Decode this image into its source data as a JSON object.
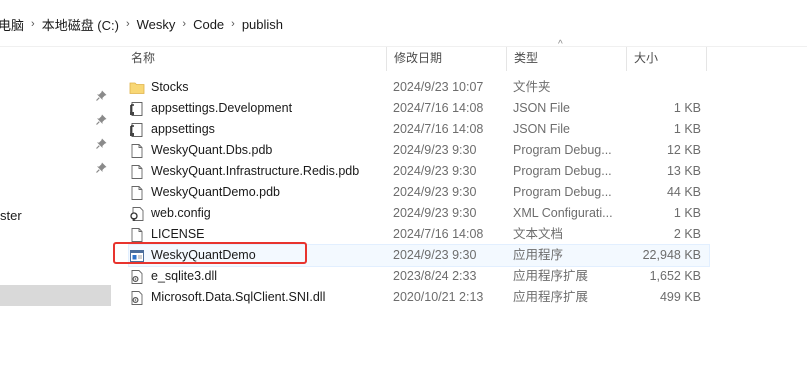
{
  "breadcrumb": {
    "items": [
      "电脑",
      "本地磁盘 (C:)",
      "Wesky",
      "Code",
      "publish"
    ],
    "separator": "›"
  },
  "sidebar": {
    "partial_label": "ster",
    "pin_icon": "pin-icon"
  },
  "columns": {
    "name": "名称",
    "date": "修改日期",
    "type": "类型",
    "size": "大小",
    "sort_indicator": "^"
  },
  "files": [
    {
      "name": "Stocks",
      "date": "2024/9/23 10:07",
      "type": "文件夹",
      "size": "",
      "icon": "folder-icon"
    },
    {
      "name": "appsettings.Development",
      "date": "2024/7/16 14:08",
      "type": "JSON File",
      "size": "1 KB",
      "icon": "json-file-icon"
    },
    {
      "name": "appsettings",
      "date": "2024/7/16 14:08",
      "type": "JSON File",
      "size": "1 KB",
      "icon": "json-file-icon"
    },
    {
      "name": "WeskyQuant.Dbs.pdb",
      "date": "2024/9/23 9:30",
      "type": "Program Debug...",
      "size": "12 KB",
      "icon": "file-icon"
    },
    {
      "name": "WeskyQuant.Infrastructure.Redis.pdb",
      "date": "2024/9/23 9:30",
      "type": "Program Debug...",
      "size": "13 KB",
      "icon": "file-icon"
    },
    {
      "name": "WeskyQuantDemo.pdb",
      "date": "2024/9/23 9:30",
      "type": "Program Debug...",
      "size": "44 KB",
      "icon": "file-icon"
    },
    {
      "name": "web.config",
      "date": "2024/9/23 9:30",
      "type": "XML Configurati...",
      "size": "1 KB",
      "icon": "config-file-icon"
    },
    {
      "name": "LICENSE",
      "date": "2024/7/16 14:08",
      "type": "文本文档",
      "size": "2 KB",
      "icon": "text-file-icon"
    },
    {
      "name": "WeskyQuantDemo",
      "date": "2024/9/23 9:30",
      "type": "应用程序",
      "size": "22,948 KB",
      "icon": "application-icon"
    },
    {
      "name": "e_sqlite3.dll",
      "date": "2023/8/24 2:33",
      "type": "应用程序扩展",
      "size": "1,652 KB",
      "icon": "dll-file-icon"
    },
    {
      "name": "Microsoft.Data.SqlClient.SNI.dll",
      "date": "2020/10/21 2:13",
      "type": "应用程序扩展",
      "size": "499 KB",
      "icon": "dll-file-icon"
    }
  ],
  "colors": {
    "highlight_box": "#e8342e",
    "folder": "#f8d775",
    "selected_sidebar": "#d9d9d9"
  }
}
